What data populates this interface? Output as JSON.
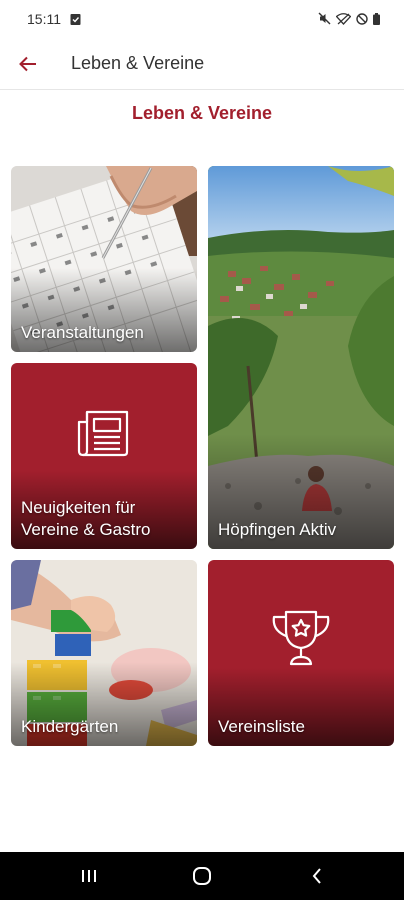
{
  "status_bar": {
    "time": "15:11"
  },
  "app_bar": {
    "title": "Leben & Vereine"
  },
  "section": {
    "title": "Leben & Vereine"
  },
  "tiles": [
    {
      "label": "Veranstaltungen",
      "type": "photo"
    },
    {
      "label": "Höpfingen Aktiv",
      "type": "photo"
    },
    {
      "label": "Neuigkeiten für Vereine & Gastro",
      "type": "icon",
      "icon": "newspaper-icon"
    },
    {
      "label": "Kindergärten",
      "type": "photo"
    },
    {
      "label": "Vereinsliste",
      "type": "icon",
      "icon": "trophy-icon"
    }
  ],
  "colors": {
    "accent": "#a21f2d",
    "nav_bar": "#000000"
  }
}
